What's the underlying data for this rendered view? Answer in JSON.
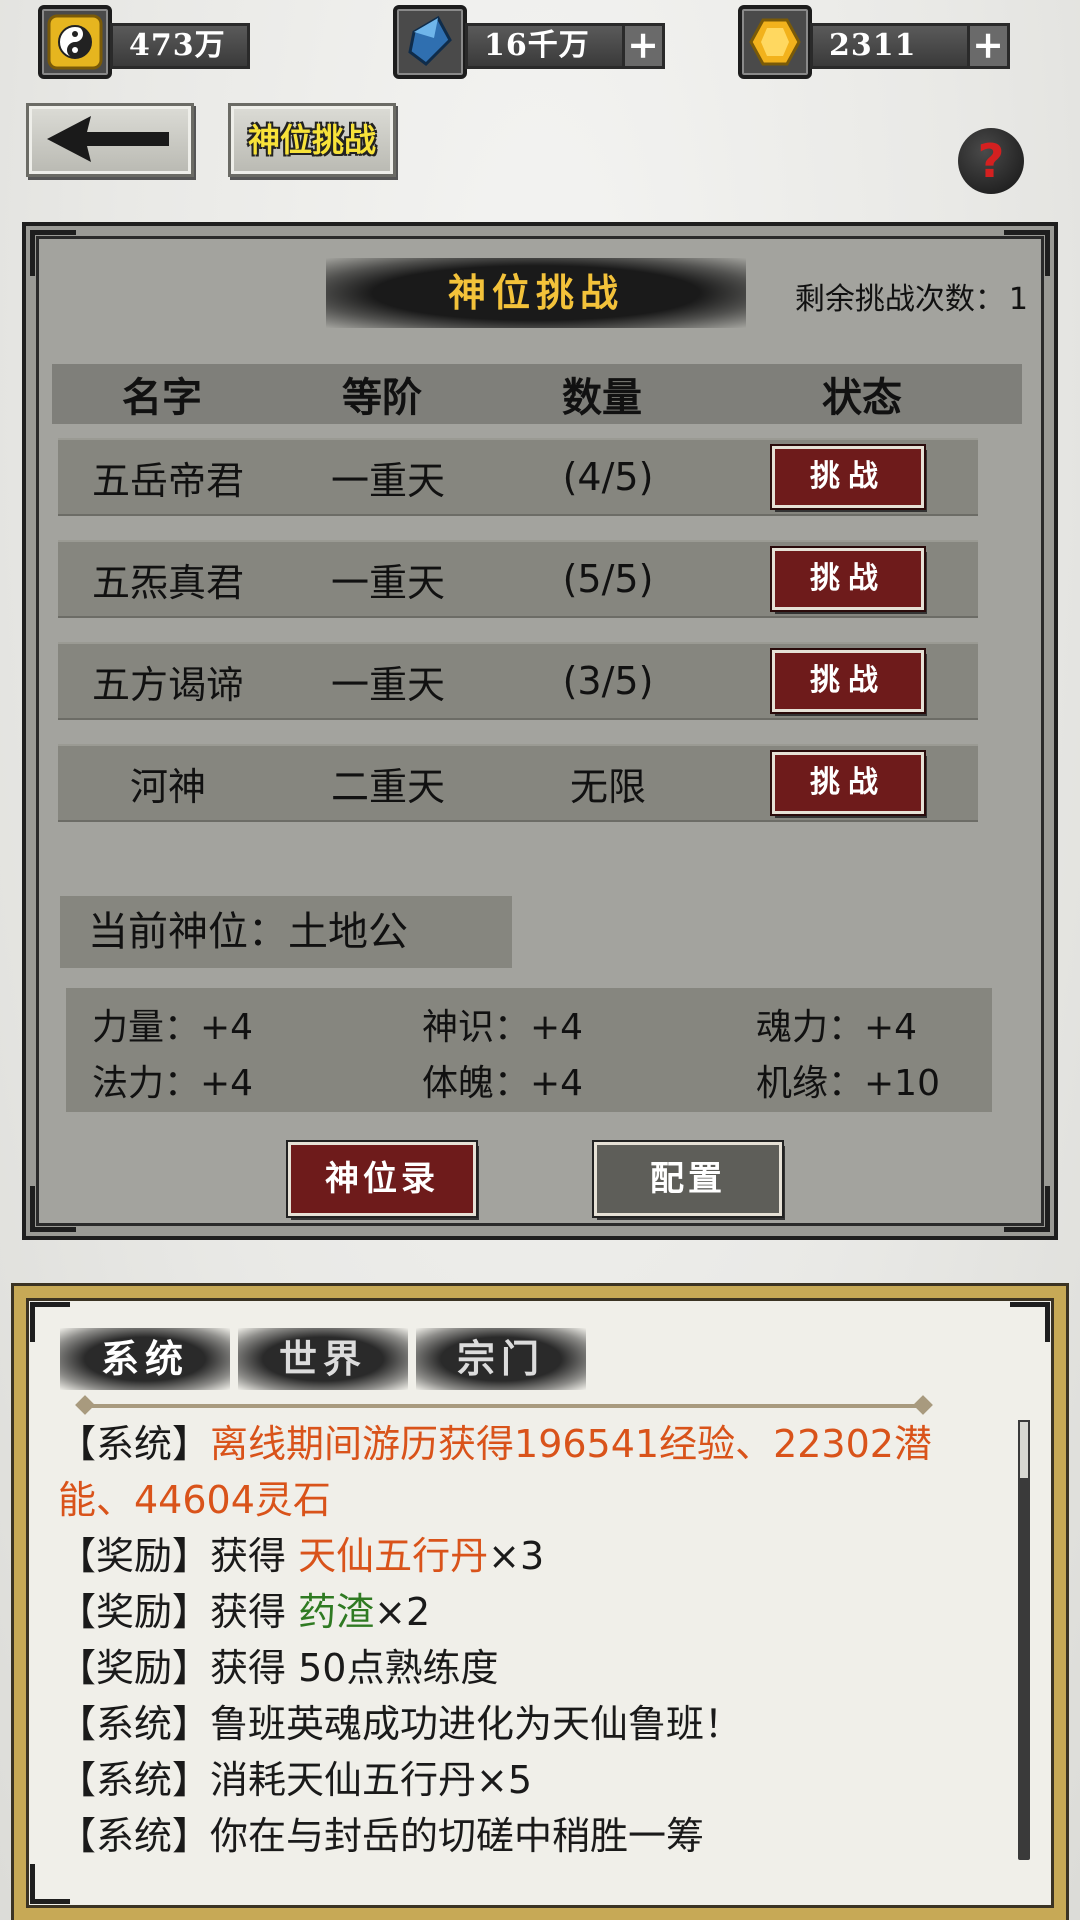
{
  "resources": [
    {
      "icon": "yin-yang-coin-icon",
      "value": "473万",
      "has_plus": false
    },
    {
      "icon": "blue-crystal-icon",
      "value": "16千万",
      "has_plus": true
    },
    {
      "icon": "gold-gem-icon",
      "value": "2311",
      "has_plus": true
    }
  ],
  "nav": {
    "back_icon": "arrow-left-icon",
    "title_tab": "神位挑战",
    "help_label": "?"
  },
  "panel": {
    "title": "神位挑战",
    "remaining_label": "剩余挑战次数：",
    "remaining_value": "1",
    "headers": {
      "name": "名字",
      "rank": "等阶",
      "count": "数量",
      "status": "状态"
    },
    "rows": [
      {
        "name": "五岳帝君",
        "rank": "一重天",
        "count": "(4/5)",
        "action": "挑战"
      },
      {
        "name": "五炁真君",
        "rank": "一重天",
        "count": "(5/5)",
        "action": "挑战"
      },
      {
        "name": "五方谒谛",
        "rank": "一重天",
        "count": "(3/5)",
        "action": "挑战"
      },
      {
        "name": "河神",
        "rank": "二重天",
        "count": "无限",
        "action": "挑战"
      }
    ],
    "current_position": "当前神位：土地公",
    "attributes": [
      {
        "label": "力量：+4"
      },
      {
        "label": "神识：+4"
      },
      {
        "label": "魂力：+4"
      },
      {
        "label": "法力：+4"
      },
      {
        "label": "体魄：+4"
      },
      {
        "label": "机缘：+10"
      }
    ],
    "buttons": {
      "record": "神位录",
      "config": "配置"
    }
  },
  "chat": {
    "tabs": [
      "系统",
      "世界",
      "宗门"
    ],
    "active_tab": "系统",
    "messages": [
      {
        "prefix": "【系统】",
        "body": "",
        "highlight": "离线期间游历获得196541经验、22302潜能、44604灵石",
        "suffix": "",
        "color": "orange"
      },
      {
        "prefix": "【奖励】",
        "body": "获得 ",
        "highlight": "天仙五行丹",
        "suffix": "×3",
        "color": "orange"
      },
      {
        "prefix": "【奖励】",
        "body": "获得 ",
        "highlight": "药渣",
        "suffix": "×2",
        "color": "green"
      },
      {
        "prefix": "【奖励】",
        "body": "获得 50点熟练度",
        "highlight": "",
        "suffix": "",
        "color": ""
      },
      {
        "prefix": "【系统】",
        "body": "鲁班英魂成功进化为天仙鲁班！",
        "highlight": "",
        "suffix": "",
        "color": ""
      },
      {
        "prefix": "【系统】",
        "body": "消耗天仙五行丹×5",
        "highlight": "",
        "suffix": "",
        "color": ""
      },
      {
        "prefix": "【系统】",
        "body": "你在与封岳的切磋中稍胜一筹",
        "highlight": "",
        "suffix": "",
        "color": ""
      }
    ]
  },
  "colors": {
    "accent_red": "#6e1b1b",
    "title_gold": "#f3c23a",
    "frame_gold": "#c7a956",
    "orange_text": "#d9531a",
    "green_text": "#2f7a22"
  }
}
